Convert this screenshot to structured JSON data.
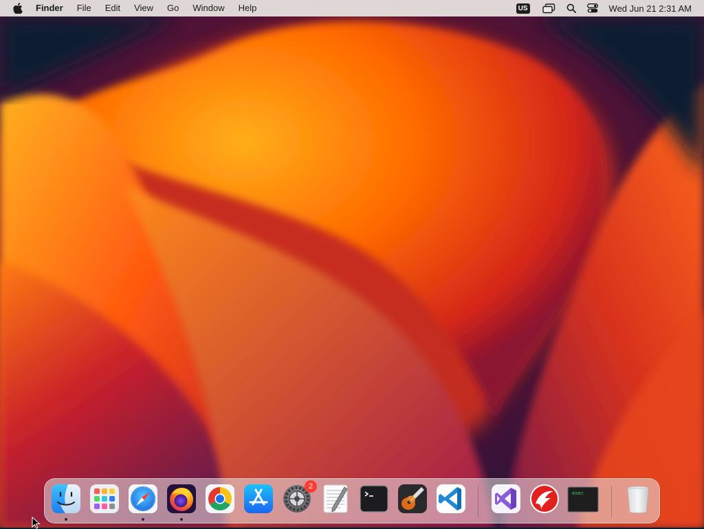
{
  "menubar": {
    "apple_icon": "apple-logo-icon",
    "app_name": "Finder",
    "menus": [
      "File",
      "Edit",
      "View",
      "Go",
      "Window",
      "Help"
    ],
    "keyboard_layout": "US",
    "clock": "Wed Jun 21  2:31 AM",
    "status_icons": [
      "input-source-icon",
      "screen-mirroring-icon",
      "spotlight-search-icon",
      "control-center-icon"
    ]
  },
  "dock": {
    "apps": [
      {
        "id": "finder",
        "icon": "finder-icon",
        "running": true
      },
      {
        "id": "launchpad",
        "icon": "launchpad-icon",
        "running": false
      },
      {
        "id": "safari",
        "icon": "safari-icon",
        "running": true
      },
      {
        "id": "firefox",
        "icon": "firefox-icon",
        "running": true
      },
      {
        "id": "chrome",
        "icon": "chrome-icon",
        "running": false
      },
      {
        "id": "app-store",
        "icon": "app-store-icon",
        "running": false
      },
      {
        "id": "system-settings",
        "icon": "system-settings-icon",
        "running": false,
        "badge": "2"
      },
      {
        "id": "textedit",
        "icon": "textedit-icon",
        "running": false
      },
      {
        "id": "terminal",
        "icon": "terminal-icon",
        "running": false
      },
      {
        "id": "garageband",
        "icon": "garageband-icon",
        "running": false
      },
      {
        "id": "vscode",
        "icon": "vscode-icon",
        "running": false
      }
    ],
    "extra_apps": [
      {
        "id": "visual-studio",
        "icon": "visual-studio-icon",
        "running": false
      },
      {
        "id": "game-launcher",
        "icon": "red-launcher-icon",
        "running": false
      },
      {
        "id": "exec",
        "icon": "exec-terminal-icon",
        "running": false,
        "label": "exec"
      }
    ],
    "trash": {
      "id": "trash",
      "icon": "trash-icon"
    }
  },
  "colors": {
    "wallpaper_background": "#0d1f33",
    "wallpaper_orange": "#ff7a00",
    "wallpaper_red": "#d8241a",
    "wallpaper_purple": "#6b1a4a",
    "badge_red": "#ff3b30"
  }
}
